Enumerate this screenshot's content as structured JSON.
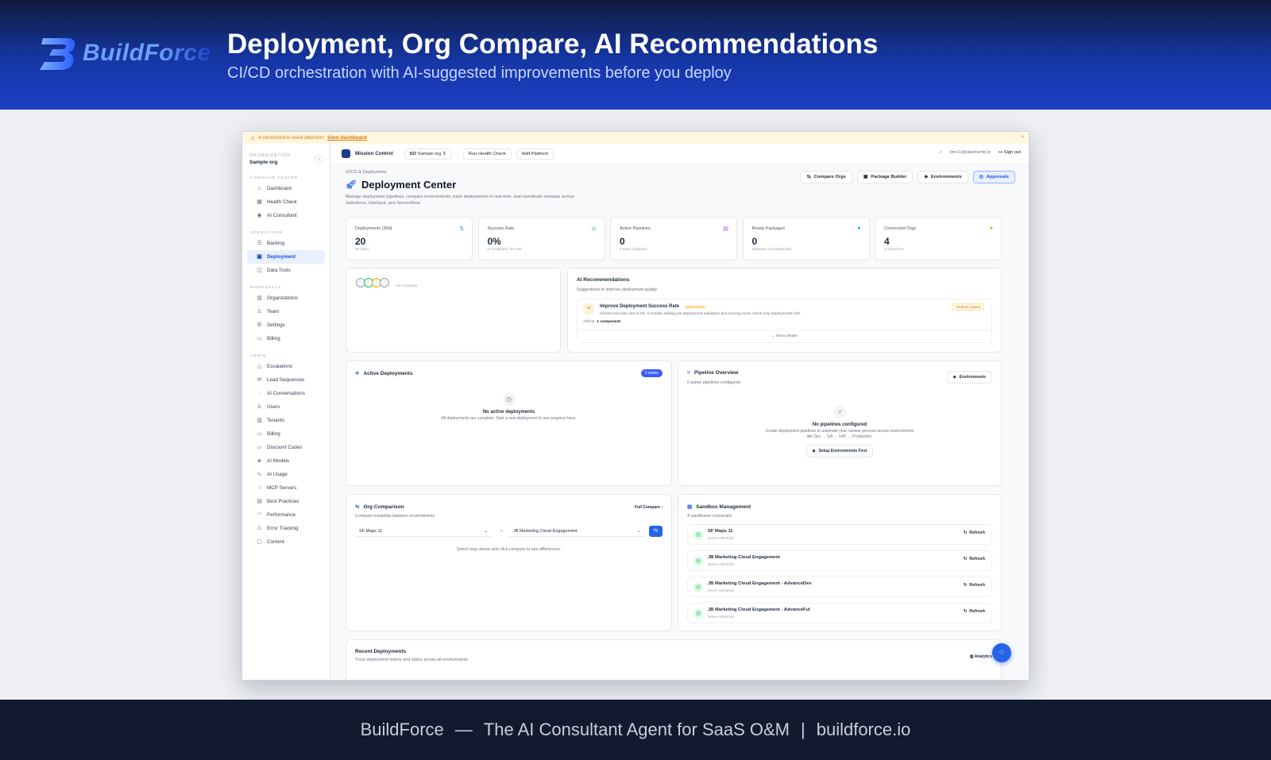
{
  "hero": {
    "brand": "BuildForce",
    "title": "Deployment, Org Compare, AI Recommendations",
    "subtitle": "CI/CD orchestration with AI-suggested improvements before you deploy"
  },
  "footer": {
    "brand": "BuildForce",
    "dash": "—",
    "tagline": "The AI Consultant Agent for SaaS O&M",
    "sep": "|",
    "url": "buildforce.io"
  },
  "app": {
    "alert": {
      "icon": "warning-icon",
      "text": "4 connections need attention",
      "link": "View dashboard",
      "close": "×"
    },
    "sidebar": {
      "org_label": "ORGANIZATION",
      "org_name": "Sample org",
      "collapse": "‹",
      "sections": [
        {
          "label": "COMMAND CENTER",
          "items": [
            {
              "icon": "⌂",
              "label": "Dashboard"
            },
            {
              "icon": "▦",
              "label": "Health Check"
            },
            {
              "icon": "◉",
              "label": "AI Consultant"
            }
          ]
        },
        {
          "label": "OPERATIONS",
          "items": [
            {
              "icon": "☰",
              "label": "Backlog"
            },
            {
              "icon": "▣",
              "label": "Deployment",
              "active": true
            },
            {
              "icon": "◫",
              "label": "Data Tools"
            }
          ]
        },
        {
          "label": "WORKSPACE",
          "items": [
            {
              "icon": "▥",
              "label": "Organizations"
            },
            {
              "icon": "♙",
              "label": "Team"
            },
            {
              "icon": "⚙",
              "label": "Settings"
            },
            {
              "icon": "▭",
              "label": "Billing"
            }
          ]
        },
        {
          "label": "ADMIN",
          "items": [
            {
              "icon": "△",
              "label": "Escalations"
            },
            {
              "icon": "✉",
              "label": "Lead Sequences"
            },
            {
              "icon": "◌",
              "label": "AI Conversations"
            },
            {
              "icon": "♙",
              "label": "Users"
            },
            {
              "icon": "▥",
              "label": "Tenants"
            },
            {
              "icon": "▭",
              "label": "Billing"
            },
            {
              "icon": "▱",
              "label": "Discount Codes"
            },
            {
              "icon": "◈",
              "label": "AI Models"
            },
            {
              "icon": "∿",
              "label": "AI Usage"
            },
            {
              "icon": "○",
              "label": "MCP Servers"
            },
            {
              "icon": "▤",
              "label": "Best Practices"
            },
            {
              "icon": "◠",
              "label": "Performance"
            },
            {
              "icon": "⚠",
              "label": "Error Tracking"
            },
            {
              "icon": "▢",
              "label": "Content"
            }
          ]
        }
      ]
    },
    "topbar": {
      "mission": "Mission Control",
      "org_badge": "SO",
      "org_select": "Sample org",
      "org_chevron": "⇕",
      "health": "Run Health Check",
      "add": "Add Platform",
      "user": "tim+1@sparksmb.io",
      "signout": "Sign out",
      "bell": "♪",
      "signout_icon": "↦"
    },
    "header": {
      "crumb": "CI/CD & Deployment",
      "title": "Deployment Center",
      "desc": "Manage deployment pipelines, compare environments, track deployments in real-time, and coordinate releases across Salesforce, HubSpot, and ServiceNow.",
      "buttons": [
        {
          "icon": "⇆",
          "label": "Compare Orgs"
        },
        {
          "icon": "▣",
          "label": "Package Builder"
        },
        {
          "icon": "◈",
          "label": "Environments"
        },
        {
          "icon": "◎",
          "label": "Approvals"
        }
      ]
    },
    "stats": [
      {
        "label": "Deployments (30d)",
        "value": "20",
        "sub": "20 failed",
        "icon": "⇅",
        "color": "#3b82f6"
      },
      {
        "label": "Success Rate",
        "value": "0%",
        "sub": "0 completed / 20 total",
        "icon": "◎",
        "color": "#22c55e"
      },
      {
        "label": "Active Pipelines",
        "value": "0",
        "sub": "0 total configured",
        "icon": "▤",
        "color": "#a855f7"
      },
      {
        "label": "Ready Packages",
        "value": "0",
        "sub": "Validated and deployable",
        "icon": "●",
        "color": "#06b6d4"
      },
      {
        "label": "Connected Orgs",
        "value": "4",
        "sub": "4 Salesforce",
        "icon": "●",
        "color": "#f59e0b"
      }
    ],
    "progress": {
      "text": "1/4 complete",
      "steps": [
        {
          "c": "#9ca3af"
        },
        {
          "c": "#22c55e"
        },
        {
          "c": "#eab308"
        },
        {
          "c": "#9ca3af"
        }
      ]
    },
    "ai": {
      "title": "AI Recommendations",
      "sub": "Suggestions to improve deployment quality",
      "rec_title": "Improve Deployment Success Rate",
      "rec_tag": "optimization",
      "rec_impact": "medium impact",
      "rec_desc": "Current success rate is 0%. Consider adding pre-deployment validation and running more check-only deployments first.",
      "affects_label": "Affects:",
      "affects_value": "1 component",
      "show": "Show details",
      "rec_icon": "✦"
    },
    "active": {
      "title": "Active Deployments",
      "badge": "0 active",
      "empty_title": "No active deployments",
      "empty_desc": "All deployments are complete. Start a new deployment to see progress here.",
      "icon": "✈",
      "empty_icon": "◷"
    },
    "pipeline": {
      "title": "Pipeline Overview",
      "sub": "0 active pipelines configured",
      "btn": "Environments",
      "empty_title": "No pipelines configured",
      "empty_desc": "Create deployment pipelines to automate your release process across environments like Dev → QA → UAT → Production.",
      "setup": "Setup Environments First",
      "icon": "⑂",
      "empty_icon": "⑂"
    },
    "compare": {
      "title": "Org Comparison",
      "sub": "Compare metadata between environments",
      "full": "Full Compare",
      "source": "SF Maps 11",
      "target": "JB Marketing Cloud Engagement",
      "hint": "Select orgs above and click compare to see differences.",
      "arrow": "→",
      "go": "⇆",
      "icon": "⇆",
      "caret": "⌄"
    },
    "sandbox": {
      "title": "Sandbox Management",
      "sub": "4 sandboxes connected",
      "refresh": "Refresh",
      "icon": "▤",
      "items": [
        {
          "name": "SF Maps 11",
          "status": "Never refreshed"
        },
        {
          "name": "JB Marketing Cloud Engagement",
          "status": "Never refreshed"
        },
        {
          "name": "JB Marketing Cloud Engagement - AdvanceDev",
          "status": "Never refreshed"
        },
        {
          "name": "JB Marketing Cloud Engagement - AdvanceFul",
          "status": "Never refreshed"
        }
      ]
    },
    "recent": {
      "title": "Recent Deployments",
      "sub": "Track deployment history and status across all environments",
      "btn": "Analytics"
    },
    "fab": "◌"
  },
  "colors": {
    "accent": "#2563eb",
    "hero_bg": "#1537a6",
    "footer_bg": "#111a2e"
  }
}
